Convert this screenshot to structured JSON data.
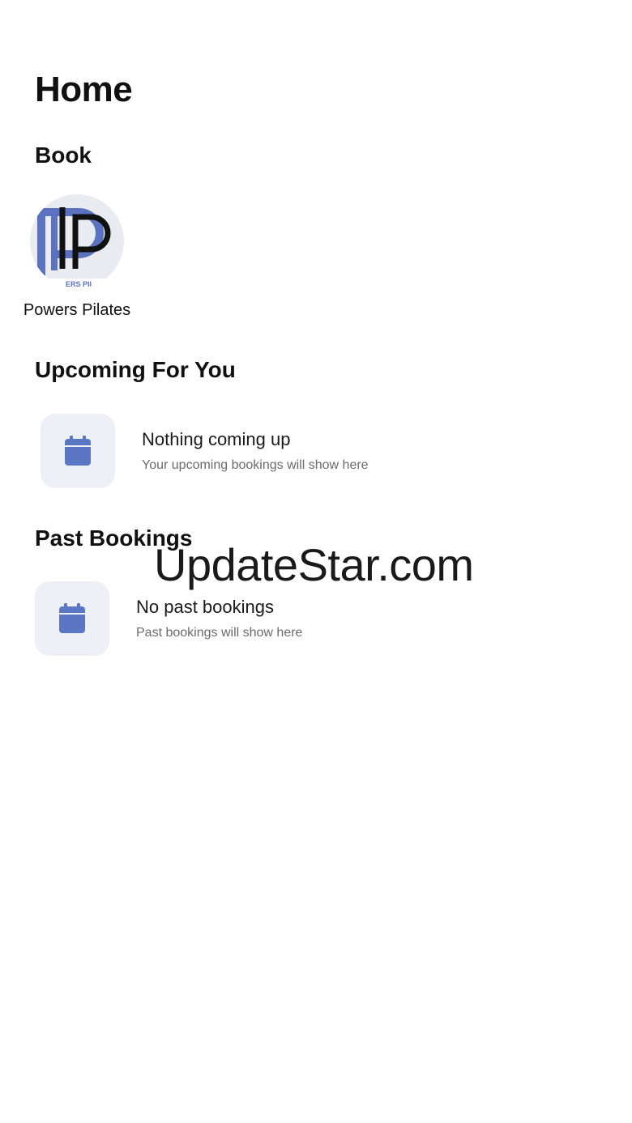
{
  "header": {
    "title": "Home"
  },
  "book": {
    "section_title": "Book",
    "studio": {
      "name": "Powers Pilates",
      "logo_icon": "powers-pilates-logo",
      "logo_text": "ERS PIL"
    }
  },
  "upcoming": {
    "section_title": "Upcoming For You",
    "empty_title": "Nothing coming up",
    "empty_subtitle": "Your upcoming bookings will show here",
    "icon": "calendar-icon"
  },
  "past": {
    "section_title": "Past Bookings",
    "empty_title": "No past bookings",
    "empty_subtitle": "Past bookings will show here",
    "icon": "calendar-icon"
  },
  "watermark": {
    "text": "UpdateStar.com"
  },
  "colors": {
    "accent": "#5b76c2",
    "icon_tile_bg": "#edf0f7",
    "logo_blue": "#5a72bf",
    "logo_black": "#111111"
  }
}
